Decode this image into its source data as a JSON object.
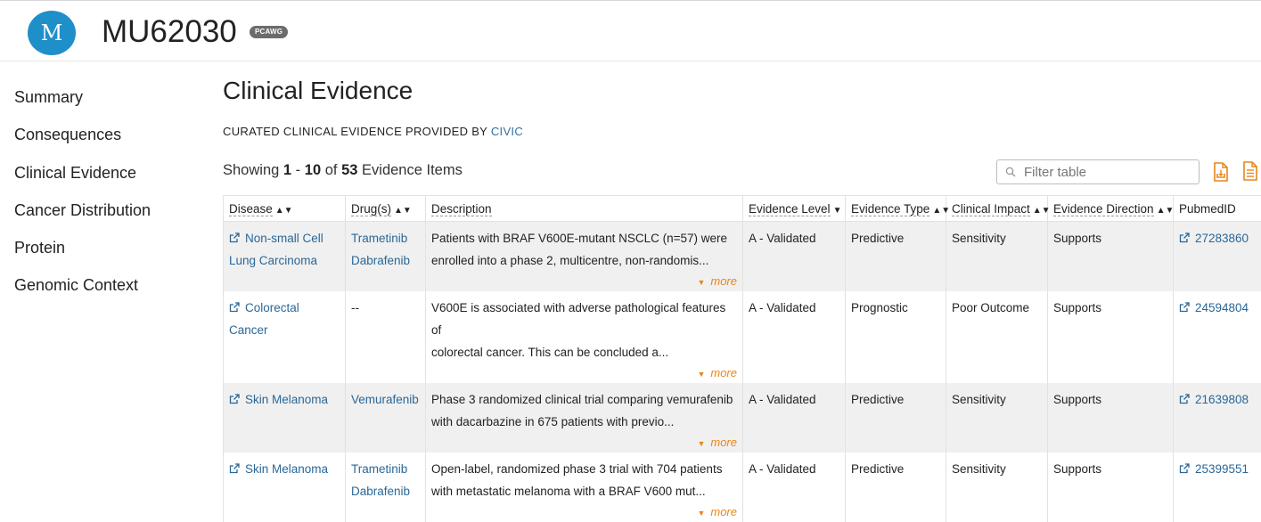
{
  "header": {
    "avatar_letter": "M",
    "title": "MU62030",
    "badge": "PCAWG"
  },
  "sidebar": {
    "items": [
      {
        "label": "Summary"
      },
      {
        "label": "Consequences"
      },
      {
        "label": "Clinical Evidence"
      },
      {
        "label": "Cancer Distribution"
      },
      {
        "label": "Protein"
      },
      {
        "label": "Genomic Context"
      }
    ]
  },
  "main": {
    "heading": "Clinical Evidence",
    "subtitle_prefix": "CURATED CLINICAL EVIDENCE PROVIDED BY",
    "subtitle_link": "CIVIC",
    "showing": {
      "prefix": "Showing",
      "from": "1",
      "dash": "-",
      "to": "10",
      "of": "of",
      "total": "53",
      "suffix": "Evidence Items"
    },
    "filter_placeholder": "Filter table",
    "accent_color": "#e8861a",
    "link_color": "#2a6797"
  },
  "table": {
    "columns": [
      {
        "label": "Disease",
        "sort": "▲▼"
      },
      {
        "label": "Drug(s)",
        "sort": "▲▼"
      },
      {
        "label": "Description",
        "sort": ""
      },
      {
        "label": "Evidence Level",
        "sort": "▼"
      },
      {
        "label": "Evidence Type",
        "sort": "▲▼"
      },
      {
        "label": "Clinical Impact",
        "sort": "▲▼"
      },
      {
        "label": "Evidence Direction",
        "sort": "▲▼"
      },
      {
        "label": "PubmedID",
        "sort": ""
      }
    ],
    "more_label": "more",
    "rows": [
      {
        "disease_line1": "Non-small Cell",
        "disease_line2": "Lung Carcinoma",
        "drug1": "Trametinib",
        "drug2": "Dabrafenib",
        "desc1": "Patients with BRAF V600E-mutant NSCLC (n=57) were",
        "desc2": "enrolled into a phase 2, multicentre, non-randomis...",
        "level": "A - Validated",
        "type": "Predictive",
        "impact": "Sensitivity",
        "direction": "Supports",
        "pubmed": "27283860"
      },
      {
        "disease_line1": "Colorectal",
        "disease_line2": "Cancer",
        "drug1": "--",
        "drug2": "",
        "desc1": "V600E is associated with adverse pathological features of",
        "desc2": "colorectal cancer. This can be concluded a...",
        "level": "A - Validated",
        "type": "Prognostic",
        "impact": "Poor Outcome",
        "direction": "Supports",
        "pubmed": "24594804"
      },
      {
        "disease_line1": "Skin Melanoma",
        "disease_line2": "",
        "drug1": "Vemurafenib",
        "drug2": "",
        "desc1": "Phase 3 randomized clinical trial comparing vemurafenib",
        "desc2": "with dacarbazine in 675 patients with previo...",
        "level": "A - Validated",
        "type": "Predictive",
        "impact": "Sensitivity",
        "direction": "Supports",
        "pubmed": "21639808"
      },
      {
        "disease_line1": "Skin Melanoma",
        "disease_line2": "",
        "drug1": "Trametinib",
        "drug2": "Dabrafenib",
        "desc1": "Open-label, randomized phase 3 trial with 704 patients",
        "desc2": "with metastatic melanoma with a BRAF V600 mut...",
        "level": "A - Validated",
        "type": "Predictive",
        "impact": "Sensitivity",
        "direction": "Supports",
        "pubmed": "25399551"
      }
    ]
  }
}
